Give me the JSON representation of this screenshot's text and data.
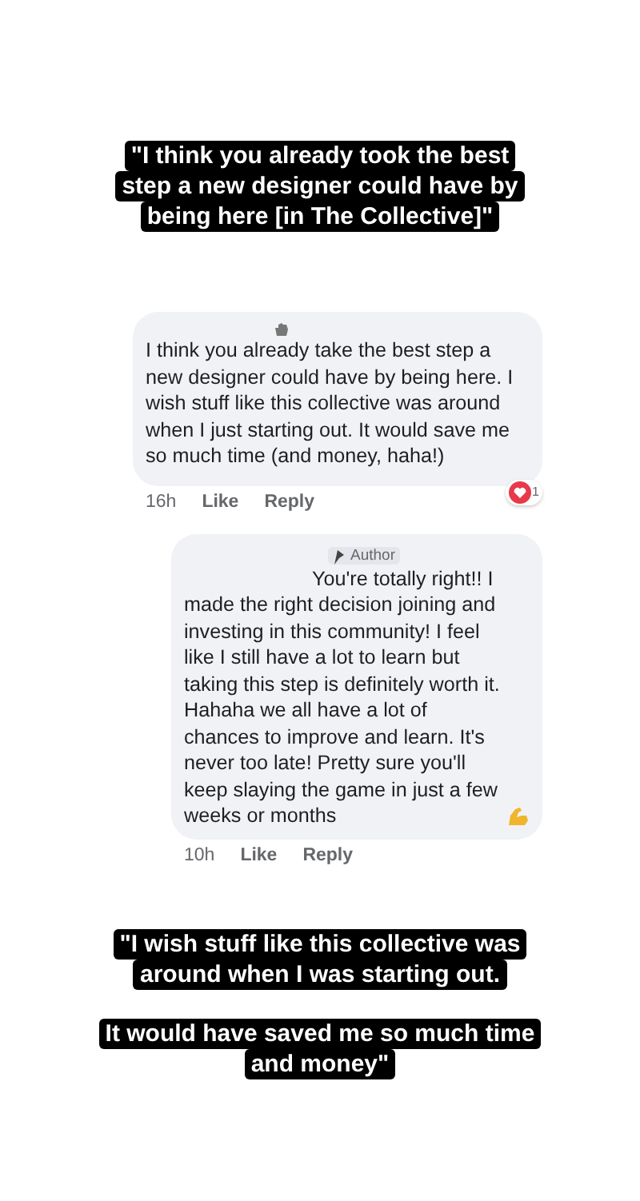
{
  "top_caption": {
    "lines": [
      "\"I think you already took the best",
      "step a new designer could have by",
      "being here [in The Collective]\""
    ]
  },
  "comment": {
    "text": "I think you already take the best step a new designer could have by being here. I wish stuff like this collective was around when I just starting out. It would save me so much time (and money, haha!)",
    "time": "16h",
    "like": "Like",
    "reply": "Reply",
    "reaction_count": "1"
  },
  "reply": {
    "badge": "Author",
    "text": "You're totally right!! I made the right decision joining and investing in this community! I feel like I still have a lot to learn but taking this step is definitely worth it. Hahaha we all have a lot of chances to improve and learn. It's never too late! Pretty sure you'll keep slaying the game in just a few weeks or months",
    "time": "10h",
    "like": "Like",
    "reply": "Reply"
  },
  "bottom_captions": [
    {
      "lines": [
        "\"I wish stuff like this collective was",
        "around when I was starting out."
      ]
    },
    {
      "lines": [
        "It would have saved me so much time",
        "and money\""
      ]
    }
  ]
}
